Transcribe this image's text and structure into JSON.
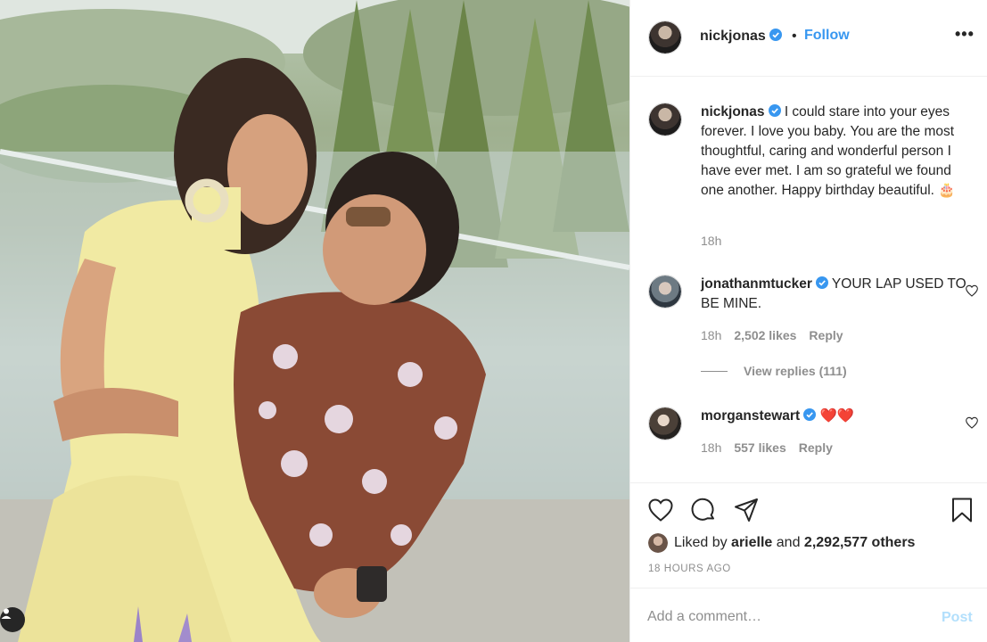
{
  "post": {
    "photo_alt": "couple photo",
    "header": {
      "username": "nickjonas",
      "separator": "•",
      "follow_label": "Follow",
      "more_label": "•••"
    },
    "caption": {
      "username": "nickjonas",
      "text": "I could stare into your eyes forever. I love you baby. You are the most thoughtful, caring and wonderful person I have ever met. I am so grateful we found one another. Happy birthday beautiful. 🎂",
      "time": "18h"
    },
    "comments": [
      {
        "username": "jonathanmtucker",
        "text": "YOUR LAP USED TO BE MINE.",
        "time": "18h",
        "likes": "2,502 likes",
        "reply_label": "Reply"
      },
      {
        "username": "morganstewart",
        "text": "❤️❤️",
        "time": "18h",
        "likes": "557 likes",
        "reply_label": "Reply"
      }
    ],
    "view_replies": "View replies (111)",
    "liked_by": {
      "prefix": "Liked by",
      "user": "arielle",
      "and": "and",
      "others": "2,292,577 others"
    },
    "time_ago": "18 HOURS AGO",
    "add_comment": {
      "placeholder": "Add a comment…",
      "post_label": "Post"
    },
    "colors": {
      "link": "#3897f0",
      "muted": "#8e8e8e",
      "post_disabled": "#b2dffc",
      "heart": "#ed4956"
    },
    "icons": [
      "heart-icon",
      "comment-icon",
      "share-icon",
      "bookmark-icon",
      "verified-icon",
      "more-icon",
      "user-tag-icon"
    ]
  }
}
